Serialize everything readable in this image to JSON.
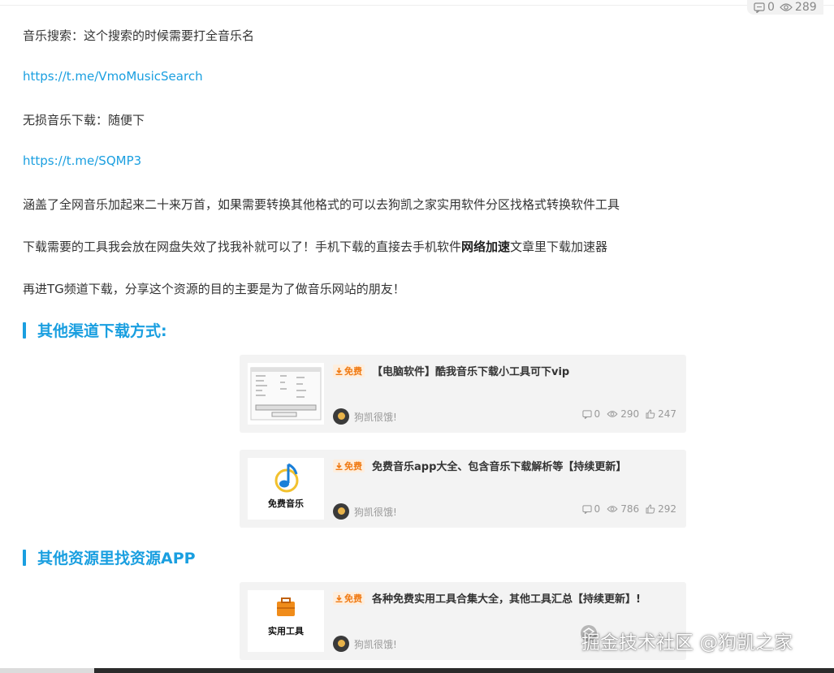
{
  "top_stats": {
    "comments": "0",
    "views": "289"
  },
  "paragraphs": {
    "p1": "音乐搜索：这个搜索的时候需要打全音乐名",
    "link1": "https://t.me/VmoMusicSearch",
    "p2": "无损音乐下载：随便下",
    "link2": "https://t.me/SQMP3",
    "p3": "涵盖了全网音乐加起来二十来万首，如果需要转换其他格式的可以去狗凯之家实用软件分区找格式转换软件工具",
    "p4_a": "下载需要的工具我会放在网盘失效了找我补就可以了！手机下载的直接去手机软件",
    "p4_b": "网络加速",
    "p4_c": "文章里下载加速器",
    "p5": "再进TG频道下载，分享这个资源的目的主要是为了做音乐网站的朋友！"
  },
  "headings": {
    "h1": "其他渠道下载方式:",
    "h2": "其他资源里找资源APP"
  },
  "cards": [
    {
      "tag": "免费",
      "title": "【电脑软件】酷我音乐下载小工具可下vip",
      "author": "狗凯很饿!",
      "comments": "0",
      "views": "290",
      "likes": "247",
      "thumb_text": ""
    },
    {
      "tag": "免费",
      "title": "免费音乐app大全、包含音乐下载解析等【持续更新】",
      "author": "狗凯很饿!",
      "comments": "0",
      "views": "786",
      "likes": "292",
      "thumb_text": "免费音乐"
    },
    {
      "tag": "免费",
      "title": "各种免费实用工具合集大全，其他工具汇总【持续更新】!",
      "author": "狗凯很饿!",
      "comments": "",
      "views": "",
      "likes": "",
      "thumb_text": "实用工具"
    }
  ],
  "watermark": "掘金技术社区 @狗凯之家",
  "colors": {
    "link": "#1a9fe0",
    "heading": "#1a9fe0",
    "tag": "#f07a13",
    "card_bg": "#f3f3f3"
  }
}
